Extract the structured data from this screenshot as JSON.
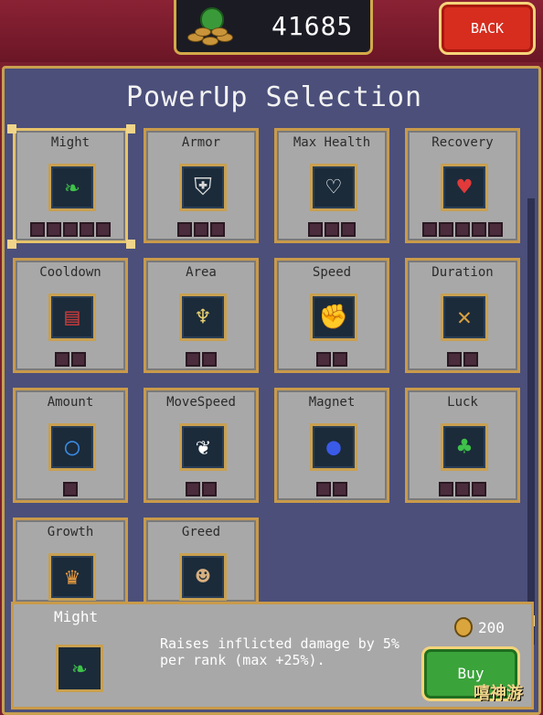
{
  "header": {
    "coin_total": "41685",
    "back_label": "BACK"
  },
  "panel": {
    "title": "PowerUp Selection"
  },
  "powerups": [
    {
      "name": "Might",
      "icon": "feather-icon",
      "glyph": "❧",
      "glyph_color": "#3ec24a",
      "ranks": 5
    },
    {
      "name": "Armor",
      "icon": "armor-icon",
      "glyph": "⛨",
      "glyph_color": "#d8d8d8",
      "ranks": 3
    },
    {
      "name": "Max Health",
      "icon": "heart-outline-icon",
      "glyph": "♡",
      "glyph_color": "#ffffff",
      "ranks": 3
    },
    {
      "name": "Recovery",
      "icon": "heart-icon",
      "glyph": "♥",
      "glyph_color": "#e23a3a",
      "ranks": 5
    },
    {
      "name": "Cooldown",
      "icon": "book-icon",
      "glyph": "▤",
      "glyph_color": "#c03a3a",
      "ranks": 2
    },
    {
      "name": "Area",
      "icon": "candelabra-icon",
      "glyph": "♆",
      "glyph_color": "#e8d070",
      "ranks": 2
    },
    {
      "name": "Speed",
      "icon": "gauntlet-icon",
      "glyph": "✊",
      "glyph_color": "#e89a9a",
      "ranks": 2
    },
    {
      "name": "Duration",
      "icon": "crossed-staves-icon",
      "glyph": "✕",
      "glyph_color": "#d8a040",
      "ranks": 2
    },
    {
      "name": "Amount",
      "icon": "ring-icon",
      "glyph": "◯",
      "glyph_color": "#3a8ae2",
      "ranks": 1
    },
    {
      "name": "MoveSpeed",
      "icon": "wing-icon",
      "glyph": "❦",
      "glyph_color": "#ffffff",
      "ranks": 2
    },
    {
      "name": "Magnet",
      "icon": "orb-icon",
      "glyph": "●",
      "glyph_color": "#3a5ae8",
      "ranks": 2
    },
    {
      "name": "Luck",
      "icon": "clover-icon",
      "glyph": "♣",
      "glyph_color": "#3ec24a",
      "ranks": 3
    },
    {
      "name": "Growth",
      "icon": "crown-icon",
      "glyph": "♛",
      "glyph_color": "#f0a040",
      "ranks": 0
    },
    {
      "name": "Greed",
      "icon": "mask-icon",
      "glyph": "☻",
      "glyph_color": "#d8b080",
      "ranks": 0
    }
  ],
  "detail": {
    "name": "Might",
    "icon": "feather-icon",
    "glyph": "❧",
    "glyph_color": "#3ec24a",
    "description": "Raises inflicted damage by 5% per rank (max +25%).",
    "price": "200",
    "buy_label": "Buy"
  },
  "watermark": "嘻神游"
}
